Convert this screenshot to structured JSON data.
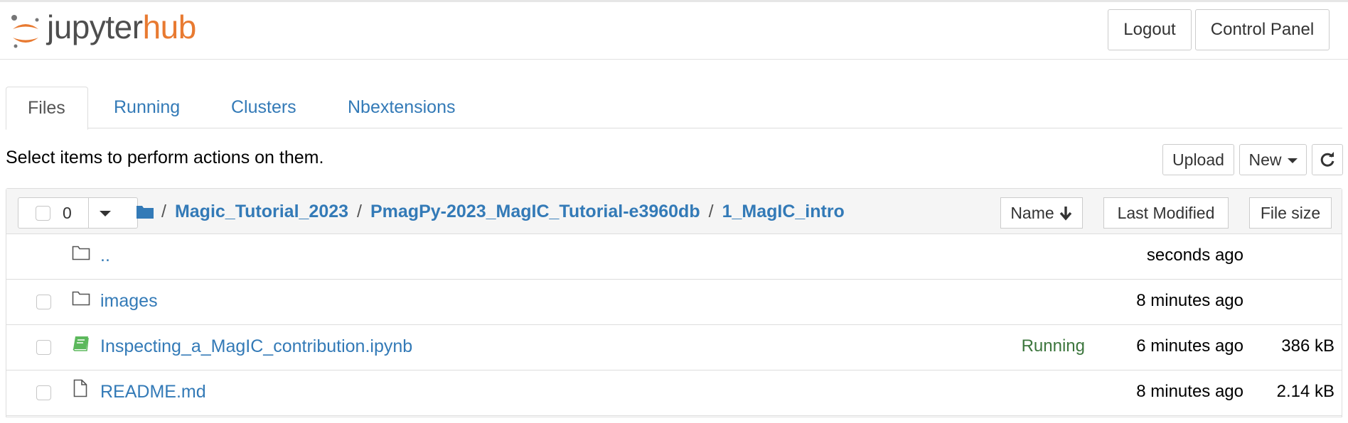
{
  "header": {
    "logo_text_a": "jupyter",
    "logo_text_b": "hub",
    "logout_label": "Logout",
    "control_panel_label": "Control Panel",
    "brand_orange": "#e87a31"
  },
  "tabs": [
    {
      "label": "Files",
      "active": true
    },
    {
      "label": "Running",
      "active": false
    },
    {
      "label": "Clusters",
      "active": false
    },
    {
      "label": "Nbextensions",
      "active": false
    }
  ],
  "toolbar": {
    "hint": "Select items to perform actions on them.",
    "upload_label": "Upload",
    "new_label": "New",
    "refresh_icon": "refresh-icon"
  },
  "list_header": {
    "selected_count": "0",
    "breadcrumb": [
      "Magic_Tutorial_2023",
      "PmagPy-2023_MagIC_Tutorial-e3960db",
      "1_MagIC_intro"
    ],
    "separator": "/",
    "sort_name_label": "Name",
    "sort_modified_label": "Last Modified",
    "sort_size_label": "File size"
  },
  "rows": [
    {
      "name": "..",
      "type": "folder",
      "status": "",
      "modified": "seconds ago",
      "size": "",
      "checkbox": false
    },
    {
      "name": "images",
      "type": "folder",
      "status": "",
      "modified": "8 minutes ago",
      "size": "",
      "checkbox": true
    },
    {
      "name": "Inspecting_a_MagIC_contribution.ipynb",
      "type": "notebook",
      "status": "Running",
      "modified": "6 minutes ago",
      "size": "386 kB",
      "checkbox": true
    },
    {
      "name": "README.md",
      "type": "file",
      "status": "",
      "modified": "8 minutes ago",
      "size": "2.14 kB",
      "checkbox": true
    }
  ],
  "colors": {
    "link": "#337ab7",
    "running": "#3c763d",
    "notebook_icon": "#5cb85c"
  }
}
